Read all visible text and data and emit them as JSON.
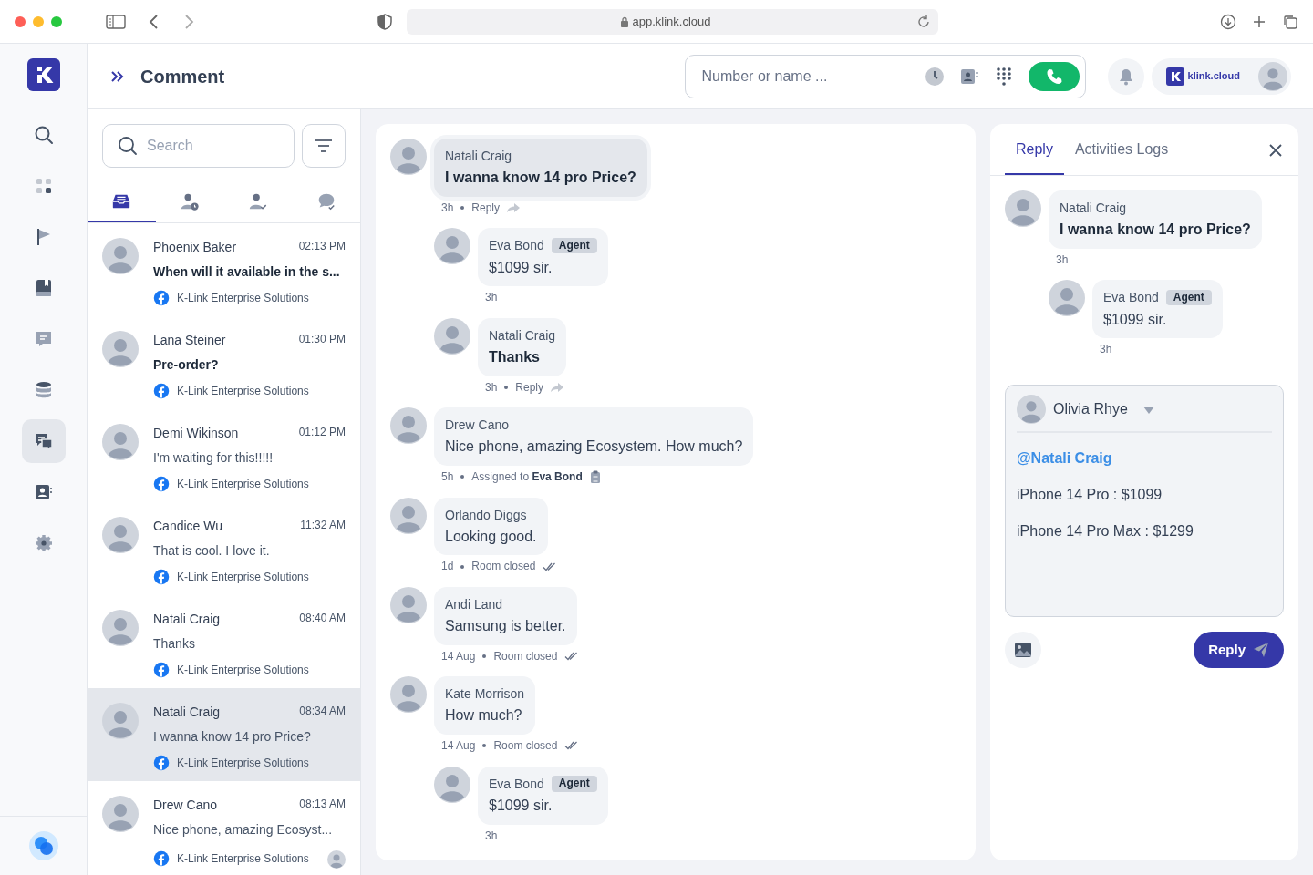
{
  "browser": {
    "url": "app.klink.cloud"
  },
  "sidebar": {
    "items": [
      {
        "selected": false
      },
      {
        "selected": false
      },
      {
        "selected": false
      },
      {
        "selected": false
      },
      {
        "selected": false
      },
      {
        "selected": false
      },
      {
        "selected": true
      },
      {
        "selected": false
      },
      {
        "selected": false
      }
    ]
  },
  "header": {
    "title": "Comment",
    "dial": {
      "placeholder": "Number or name ..."
    },
    "brand": "klink.cloud"
  },
  "inbox": {
    "search": {
      "placeholder": "Search"
    },
    "tabs": [
      {
        "selected": true
      },
      {
        "selected": false
      },
      {
        "selected": false
      },
      {
        "selected": false
      }
    ],
    "conversations": [
      {
        "name": "Phoenix Baker",
        "time": "02:13 PM",
        "preview": "When will it available in the s...",
        "unread": true,
        "source": "K-Link Enterprise Solutions",
        "selected": false,
        "assignee": false
      },
      {
        "name": "Lana Steiner",
        "time": "01:30 PM",
        "preview": "Pre-order?",
        "unread": true,
        "source": "K-Link Enterprise Solutions",
        "selected": false,
        "assignee": false
      },
      {
        "name": "Demi Wikinson",
        "time": "01:12 PM",
        "preview": "I'm waiting for this!!!!!",
        "unread": false,
        "source": "K-Link Enterprise Solutions",
        "selected": false,
        "assignee": false
      },
      {
        "name": "Candice Wu",
        "time": "11:32 AM",
        "preview": "That is cool. I love it.",
        "unread": false,
        "source": "K-Link Enterprise Solutions",
        "selected": false,
        "assignee": false
      },
      {
        "name": "Natali Craig",
        "time": "08:40 AM",
        "preview": "Thanks",
        "unread": false,
        "source": "K-Link Enterprise Solutions",
        "selected": false,
        "assignee": false
      },
      {
        "name": "Natali Craig",
        "time": "08:34 AM",
        "preview": "I wanna know 14 pro Price?",
        "unread": false,
        "source": "K-Link Enterprise Solutions",
        "selected": true,
        "assignee": false
      },
      {
        "name": "Drew Cano",
        "time": "08:13 AM",
        "preview": "Nice phone, amazing Ecosyst...",
        "unread": false,
        "source": "K-Link Enterprise Solutions",
        "selected": false,
        "assignee": true
      }
    ]
  },
  "thread": {
    "messages": [
      {
        "author": "Natali Craig",
        "text": "I wanna know 14 pro Price?",
        "bold": true,
        "highlighted": true,
        "time": "3h",
        "action": "Reply",
        "kind": "reply",
        "children": [
          {
            "author": "Eva Bond",
            "badge": "Agent",
            "text": "$1099 sir.",
            "bold": false,
            "highlighted": false,
            "time": "3h"
          },
          {
            "author": "Natali Craig",
            "text": "Thanks",
            "bold": true,
            "highlighted": false,
            "time": "3h",
            "action": "Reply",
            "kind": "reply"
          }
        ]
      },
      {
        "author": "Drew Cano",
        "text": "Nice phone, amazing Ecosystem. How much?",
        "bold": false,
        "highlighted": false,
        "time": "5h",
        "action": "Assigned to **Eva Bond**",
        "kind": "assigned"
      },
      {
        "author": "Orlando Diggs",
        "text": "Looking good.",
        "bold": false,
        "highlighted": false,
        "time": "1d",
        "action": "Room closed",
        "kind": "closed"
      },
      {
        "author": "Andi Land",
        "text": "Samsung is better.",
        "bold": false,
        "highlighted": false,
        "time": "14 Aug",
        "action": "Room closed",
        "kind": "closed"
      },
      {
        "author": "Kate Morrison",
        "text": "How much?",
        "bold": false,
        "highlighted": false,
        "time": "14 Aug",
        "action": "Room closed",
        "kind": "closed",
        "children": [
          {
            "author": "Eva Bond",
            "badge": "Agent",
            "text": "$1099 sir.",
            "bold": false,
            "highlighted": false,
            "time": "3h"
          }
        ]
      }
    ]
  },
  "reply_panel": {
    "tabs": [
      {
        "label": "Reply",
        "selected": true
      },
      {
        "label": "Activities Logs",
        "selected": false
      }
    ],
    "messages": [
      {
        "author": "Natali Craig",
        "text": "I wanna know 14 pro Price?",
        "bold": true,
        "highlighted": false,
        "time": "3h",
        "children": [
          {
            "author": "Eva Bond",
            "badge": "Agent",
            "text": "$1099 sir.",
            "bold": false,
            "highlighted": false,
            "time": "3h"
          }
        ]
      }
    ],
    "composer": {
      "author": "Olivia Rhye",
      "mention": "@Natali Craig",
      "lines": [
        "iPhone 14 Pro : $1099",
        "iPhone 14 Pro Max : $1299"
      ]
    },
    "send_label": "Reply"
  }
}
